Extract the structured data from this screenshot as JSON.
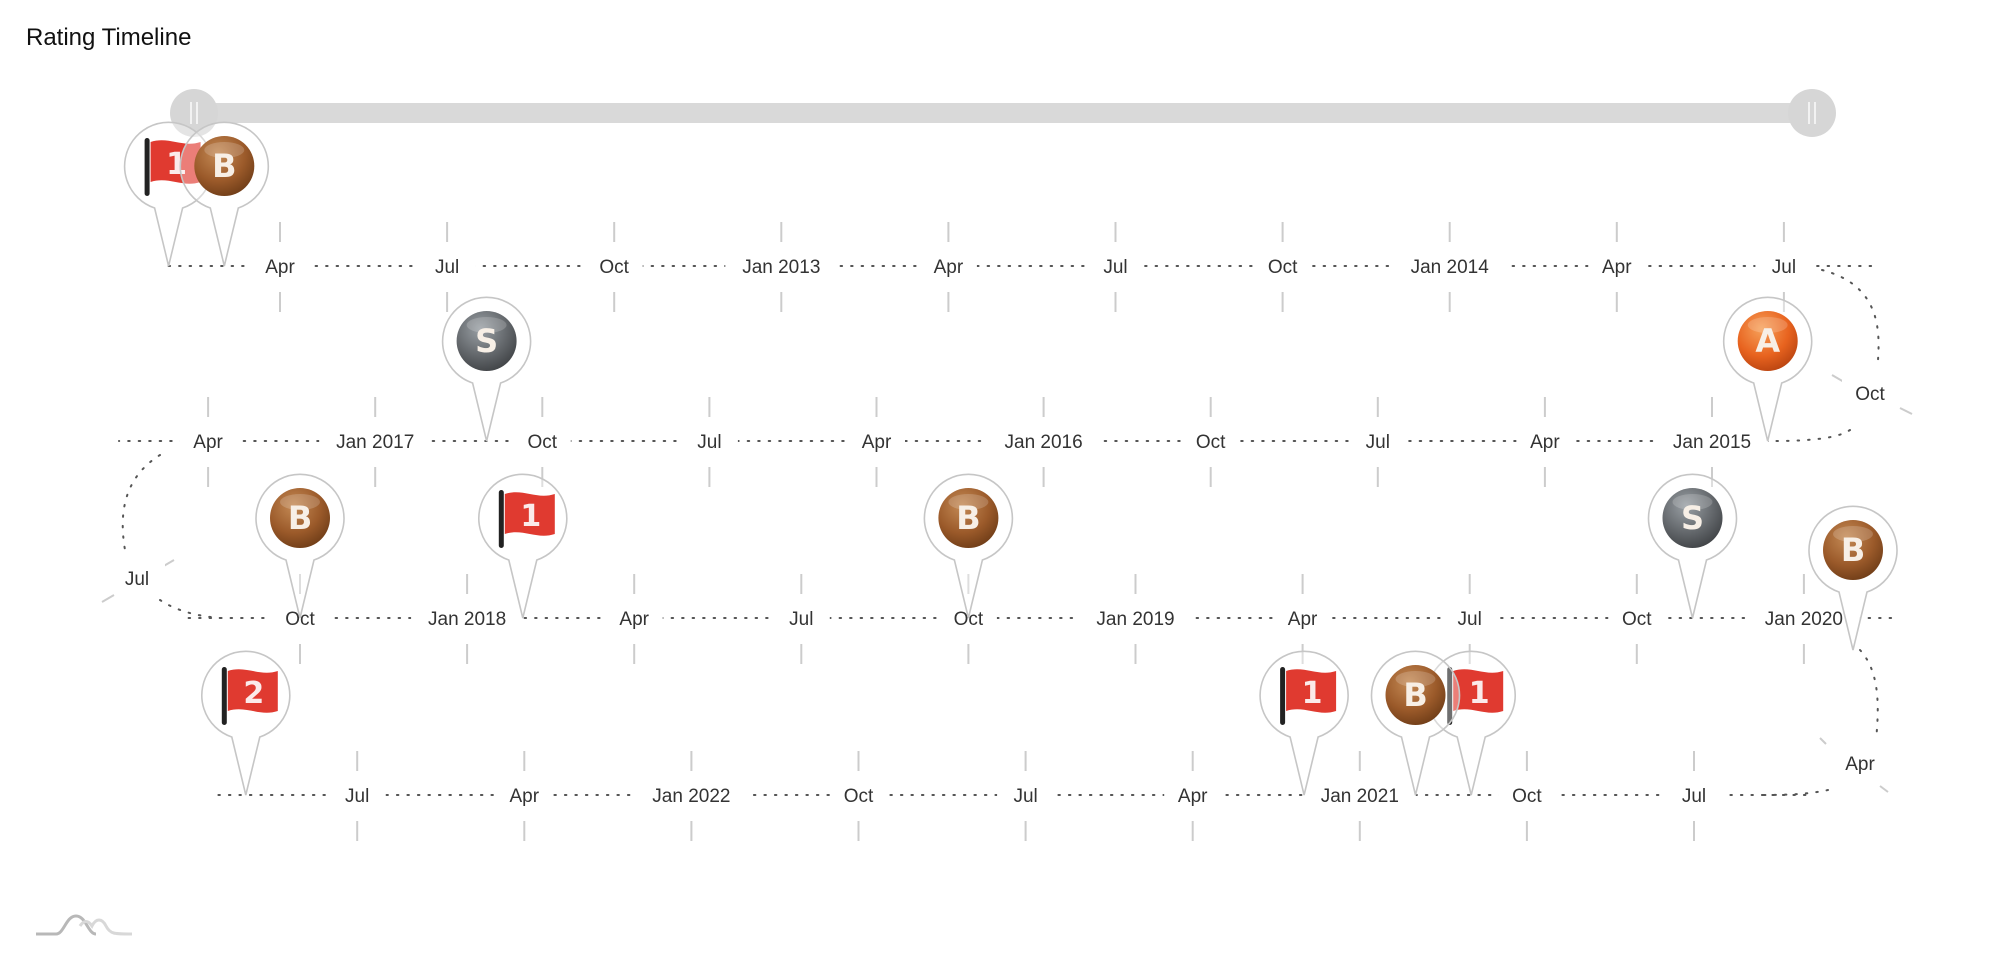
{
  "title": "Rating Timeline",
  "slider": {
    "range_start": "Feb 2012",
    "range_end": "Sep 2022"
  },
  "colors": {
    "flag_red": "#e03a30",
    "bronze": "#9b5a2a",
    "silver": "#63676b",
    "gold_orange": "#e8631f",
    "axis_dots": "#555555",
    "tick": "#cccccc",
    "slider": "#d9d9d9"
  },
  "chart_data": {
    "type": "timeline",
    "title": "Rating Timeline",
    "layout": "serpentine, 4 rows alternating direction",
    "range": [
      "2012-02",
      "2022-09"
    ],
    "axis_ticks": [
      {
        "date": "2012-04",
        "label": "Apr"
      },
      {
        "date": "2012-07",
        "label": "Jul"
      },
      {
        "date": "2012-10",
        "label": "Oct"
      },
      {
        "date": "2013-01",
        "label": "Jan 2013"
      },
      {
        "date": "2013-04",
        "label": "Apr"
      },
      {
        "date": "2013-07",
        "label": "Jul"
      },
      {
        "date": "2013-10",
        "label": "Oct"
      },
      {
        "date": "2014-01",
        "label": "Jan 2014"
      },
      {
        "date": "2014-04",
        "label": "Apr"
      },
      {
        "date": "2014-07",
        "label": "Jul"
      },
      {
        "date": "2014-10",
        "label": "Oct"
      },
      {
        "date": "2015-01",
        "label": "Jan 2015"
      },
      {
        "date": "2015-04",
        "label": "Apr"
      },
      {
        "date": "2015-07",
        "label": "Jul"
      },
      {
        "date": "2015-10",
        "label": "Oct"
      },
      {
        "date": "2016-01",
        "label": "Jan 2016"
      },
      {
        "date": "2016-04",
        "label": "Apr"
      },
      {
        "date": "2016-07",
        "label": "Jul"
      },
      {
        "date": "2016-10",
        "label": "Oct"
      },
      {
        "date": "2017-01",
        "label": "Jan 2017"
      },
      {
        "date": "2017-04",
        "label": "Apr"
      },
      {
        "date": "2017-07",
        "label": "Jul"
      },
      {
        "date": "2017-10",
        "label": "Oct"
      },
      {
        "date": "2018-01",
        "label": "Jan 2018"
      },
      {
        "date": "2018-04",
        "label": "Apr"
      },
      {
        "date": "2018-07",
        "label": "Jul"
      },
      {
        "date": "2018-10",
        "label": "Oct"
      },
      {
        "date": "2019-01",
        "label": "Jan 2019"
      },
      {
        "date": "2019-04",
        "label": "Apr"
      },
      {
        "date": "2019-07",
        "label": "Jul"
      },
      {
        "date": "2019-10",
        "label": "Oct"
      },
      {
        "date": "2020-01",
        "label": "Jan 2020"
      },
      {
        "date": "2020-04",
        "label": "Apr"
      },
      {
        "date": "2020-07",
        "label": "Jul"
      },
      {
        "date": "2020-10",
        "label": "Oct"
      },
      {
        "date": "2021-01",
        "label": "Jan 2021"
      },
      {
        "date": "2021-04",
        "label": "Apr"
      },
      {
        "date": "2021-07",
        "label": "Jul"
      },
      {
        "date": "2021-10",
        "label": "Oct"
      },
      {
        "date": "2022-01",
        "label": "Jan 2022"
      },
      {
        "date": "2022-04",
        "label": "Apr"
      },
      {
        "date": "2022-07",
        "label": "Jul"
      }
    ],
    "events": [
      {
        "date": "2012-02",
        "type": "flag",
        "label": "1"
      },
      {
        "date": "2012-03",
        "type": "bronze",
        "label": "B"
      },
      {
        "date": "2014-12",
        "type": "gold",
        "label": "A"
      },
      {
        "date": "2016-11",
        "type": "silver",
        "label": "S"
      },
      {
        "date": "2017-10",
        "type": "bronze",
        "label": "B"
      },
      {
        "date": "2018-02",
        "type": "flag",
        "label": "1"
      },
      {
        "date": "2018-10",
        "type": "bronze",
        "label": "B"
      },
      {
        "date": "2019-11",
        "type": "silver",
        "label": "S"
      },
      {
        "date": "2020-02",
        "type": "bronze",
        "label": "B"
      },
      {
        "date": "2020-11",
        "type": "flag",
        "label": "1"
      },
      {
        "date": "2020-12",
        "type": "bronze",
        "label": "B"
      },
      {
        "date": "2021-02",
        "type": "flag",
        "label": "1"
      },
      {
        "date": "2022-09",
        "type": "flag",
        "label": "2"
      }
    ]
  }
}
